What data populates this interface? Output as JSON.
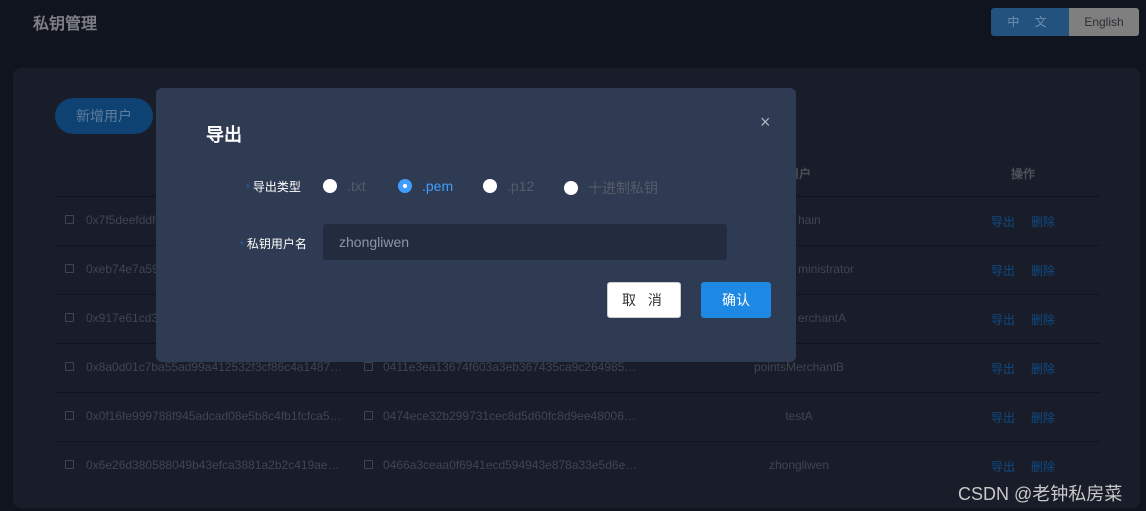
{
  "header": {
    "title": "私钥管理",
    "lang_zh": "中 文",
    "lang_en": "English"
  },
  "toolbar": {
    "add_user": "新增用户"
  },
  "table": {
    "headers": {
      "user": "用户",
      "actions": "操作"
    },
    "rows": [
      {
        "address": "0x7f5deefddf",
        "pubkey": "",
        "user": "hain"
      },
      {
        "address": "0xeb74e7a59",
        "pubkey": "",
        "user": "ministrator"
      },
      {
        "address": "0x917e61cd3",
        "pubkey": "",
        "user": "erchantA"
      },
      {
        "address": "0x8a0d01c7ba55ad99a412532f3cf86c4a1487…",
        "pubkey": "0411e3ea13674f603a3eb367435ca9c264985…",
        "user": "pointsMerchantB"
      },
      {
        "address": "0x0f16fe999788f945adcad08e5b8c4fb1fcfca5…",
        "pubkey": "0474ece32b299731cec8d5d60fc8d9ee48006…",
        "user": "testA"
      },
      {
        "address": "0x6e26d380588049b43efca3881a2b2c419ae…",
        "pubkey": "0466a3ceaa0f6941ecd594943e878a33e5d6e…",
        "user": "zhongliwen"
      }
    ],
    "export_label": "导出",
    "delete_label": "删除"
  },
  "modal": {
    "title": "导出",
    "close": "×",
    "type_label": "导出类型",
    "user_label": "私钥用户名",
    "options": [
      ".txt",
      ".pem",
      ".p12",
      "十进制私钥"
    ],
    "selected": ".pem",
    "username": "zhongliwen",
    "cancel": "取 消",
    "confirm": "确认"
  },
  "watermark": "CSDN @老钟私房菜"
}
